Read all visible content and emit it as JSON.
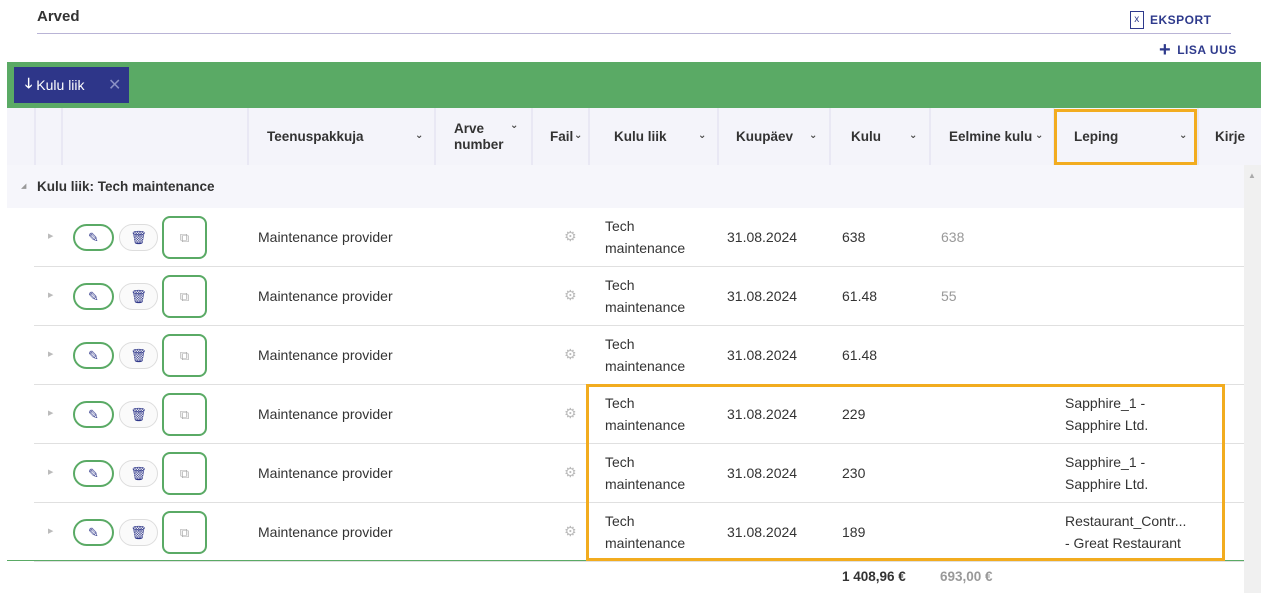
{
  "page": {
    "title": "Arved"
  },
  "actions": {
    "export_label": "EKSPORT",
    "export_icon": "excel-file-icon",
    "add_label": "LISA UUS",
    "add_icon": "plus-icon"
  },
  "grouping": {
    "chip_label": "Kulu liik",
    "chip_icon": "arrow-down-icon"
  },
  "columns": {
    "teenuspakkuja": "Teenuspakkuja",
    "arve_number_1": "Arve",
    "arve_number_2": "number",
    "fail": "Fail",
    "kulu_liik": "Kulu liik",
    "kuupaev": "Kuupäev",
    "kulu": "Kulu",
    "eelmine_kulu": "Eelmine kulu",
    "leping": "Leping",
    "kirje": "Kirje"
  },
  "group": {
    "label": "Kulu liik: Tech maintenance"
  },
  "rows": [
    {
      "provider": "Maintenance provider",
      "type_1": "Tech",
      "type_2": "maintenance",
      "date": "31.08.2024",
      "cost": "638",
      "prev_cost": "638",
      "contract_1": "",
      "contract_2": ""
    },
    {
      "provider": "Maintenance provider",
      "type_1": "Tech",
      "type_2": "maintenance",
      "date": "31.08.2024",
      "cost": "61.48",
      "prev_cost": "55",
      "contract_1": "",
      "contract_2": ""
    },
    {
      "provider": "Maintenance provider",
      "type_1": "Tech",
      "type_2": "maintenance",
      "date": "31.08.2024",
      "cost": "61.48",
      "prev_cost": "",
      "contract_1": "",
      "contract_2": ""
    },
    {
      "provider": "Maintenance provider",
      "type_1": "Tech",
      "type_2": "maintenance",
      "date": "31.08.2024",
      "cost": "229",
      "prev_cost": "",
      "contract_1": "Sapphire_1 -",
      "contract_2": "Sapphire Ltd."
    },
    {
      "provider": "Maintenance provider",
      "type_1": "Tech",
      "type_2": "maintenance",
      "date": "31.08.2024",
      "cost": "230",
      "prev_cost": "",
      "contract_1": "Sapphire_1 -",
      "contract_2": "Sapphire Ltd."
    },
    {
      "provider": "Maintenance provider",
      "type_1": "Tech",
      "type_2": "maintenance",
      "date": "31.08.2024",
      "cost": "189",
      "prev_cost": "",
      "contract_1": "Restaurant_Contr...",
      "contract_2": "- Great Restaurant"
    }
  ],
  "totals": {
    "cost": "1 408,96 €",
    "prev_cost": "693,00 €"
  },
  "colors": {
    "green": "#5aaa65",
    "navy": "#2e3689",
    "highlight": "#f2ac1f"
  }
}
